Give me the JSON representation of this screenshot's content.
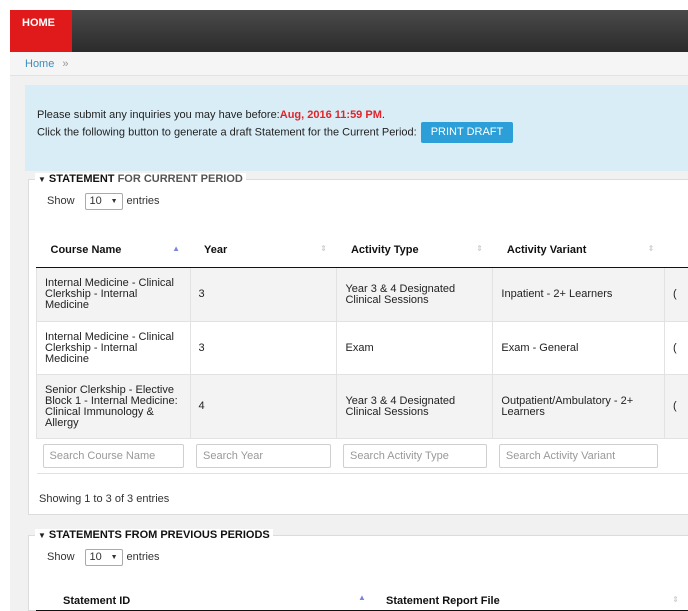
{
  "nav": {
    "home_tab": "HOME"
  },
  "breadcrumb": {
    "home": "Home",
    "separator": "»"
  },
  "notice": {
    "line1_prefix": "Please submit any inquiries you may have before:",
    "deadline": "Aug, 2016 11:59 PM",
    "line1_suffix": ".",
    "line2": "Click the following button to generate a draft Statement for the Current Period:",
    "print_button": "PRINT DRAFT"
  },
  "current": {
    "legend_bold": "STATEMENT",
    "legend_rest": " FOR CURRENT PERIOD",
    "show_label": "Show",
    "page_size": "10",
    "entries_label": "entries",
    "columns": [
      "Course Name",
      "Year",
      "Activity Type",
      "Activity Variant"
    ],
    "rows": [
      {
        "course": "Internal Medicine - Clinical Clerkship - Internal Medicine",
        "year": "3",
        "type": "Year 3 & 4 Designated Clinical Sessions",
        "variant": "Inpatient - 2+ Learners",
        "extra": "("
      },
      {
        "course": "Internal Medicine - Clinical Clerkship - Internal Medicine",
        "year": "3",
        "type": "Exam",
        "variant": "Exam - General",
        "extra": "("
      },
      {
        "course": "Senior Clerkship - Elective Block 1 - Internal Medicine: Clinical Immunology & Allergy",
        "year": "4",
        "type": "Year 3 & 4 Designated Clinical Sessions",
        "variant": "Outpatient/Ambulatory - 2+ Learners",
        "extra": "("
      }
    ],
    "search_placeholders": [
      "Search Course Name",
      "Search Year",
      "Search Activity Type",
      "Search Activity Variant"
    ],
    "info": "Showing 1 to 3 of 3 entries"
  },
  "previous": {
    "legend": "STATEMENTS FROM PREVIOUS PERIODS",
    "show_label": "Show",
    "page_size": "10",
    "entries_label": "entries",
    "columns": [
      "Statement ID",
      "Statement Report File"
    ]
  },
  "colors": {
    "home_tab": "#e0191b",
    "accent": "#2c9fd8",
    "deadline": "#e2242a",
    "notice_bg": "#d9edf7"
  }
}
